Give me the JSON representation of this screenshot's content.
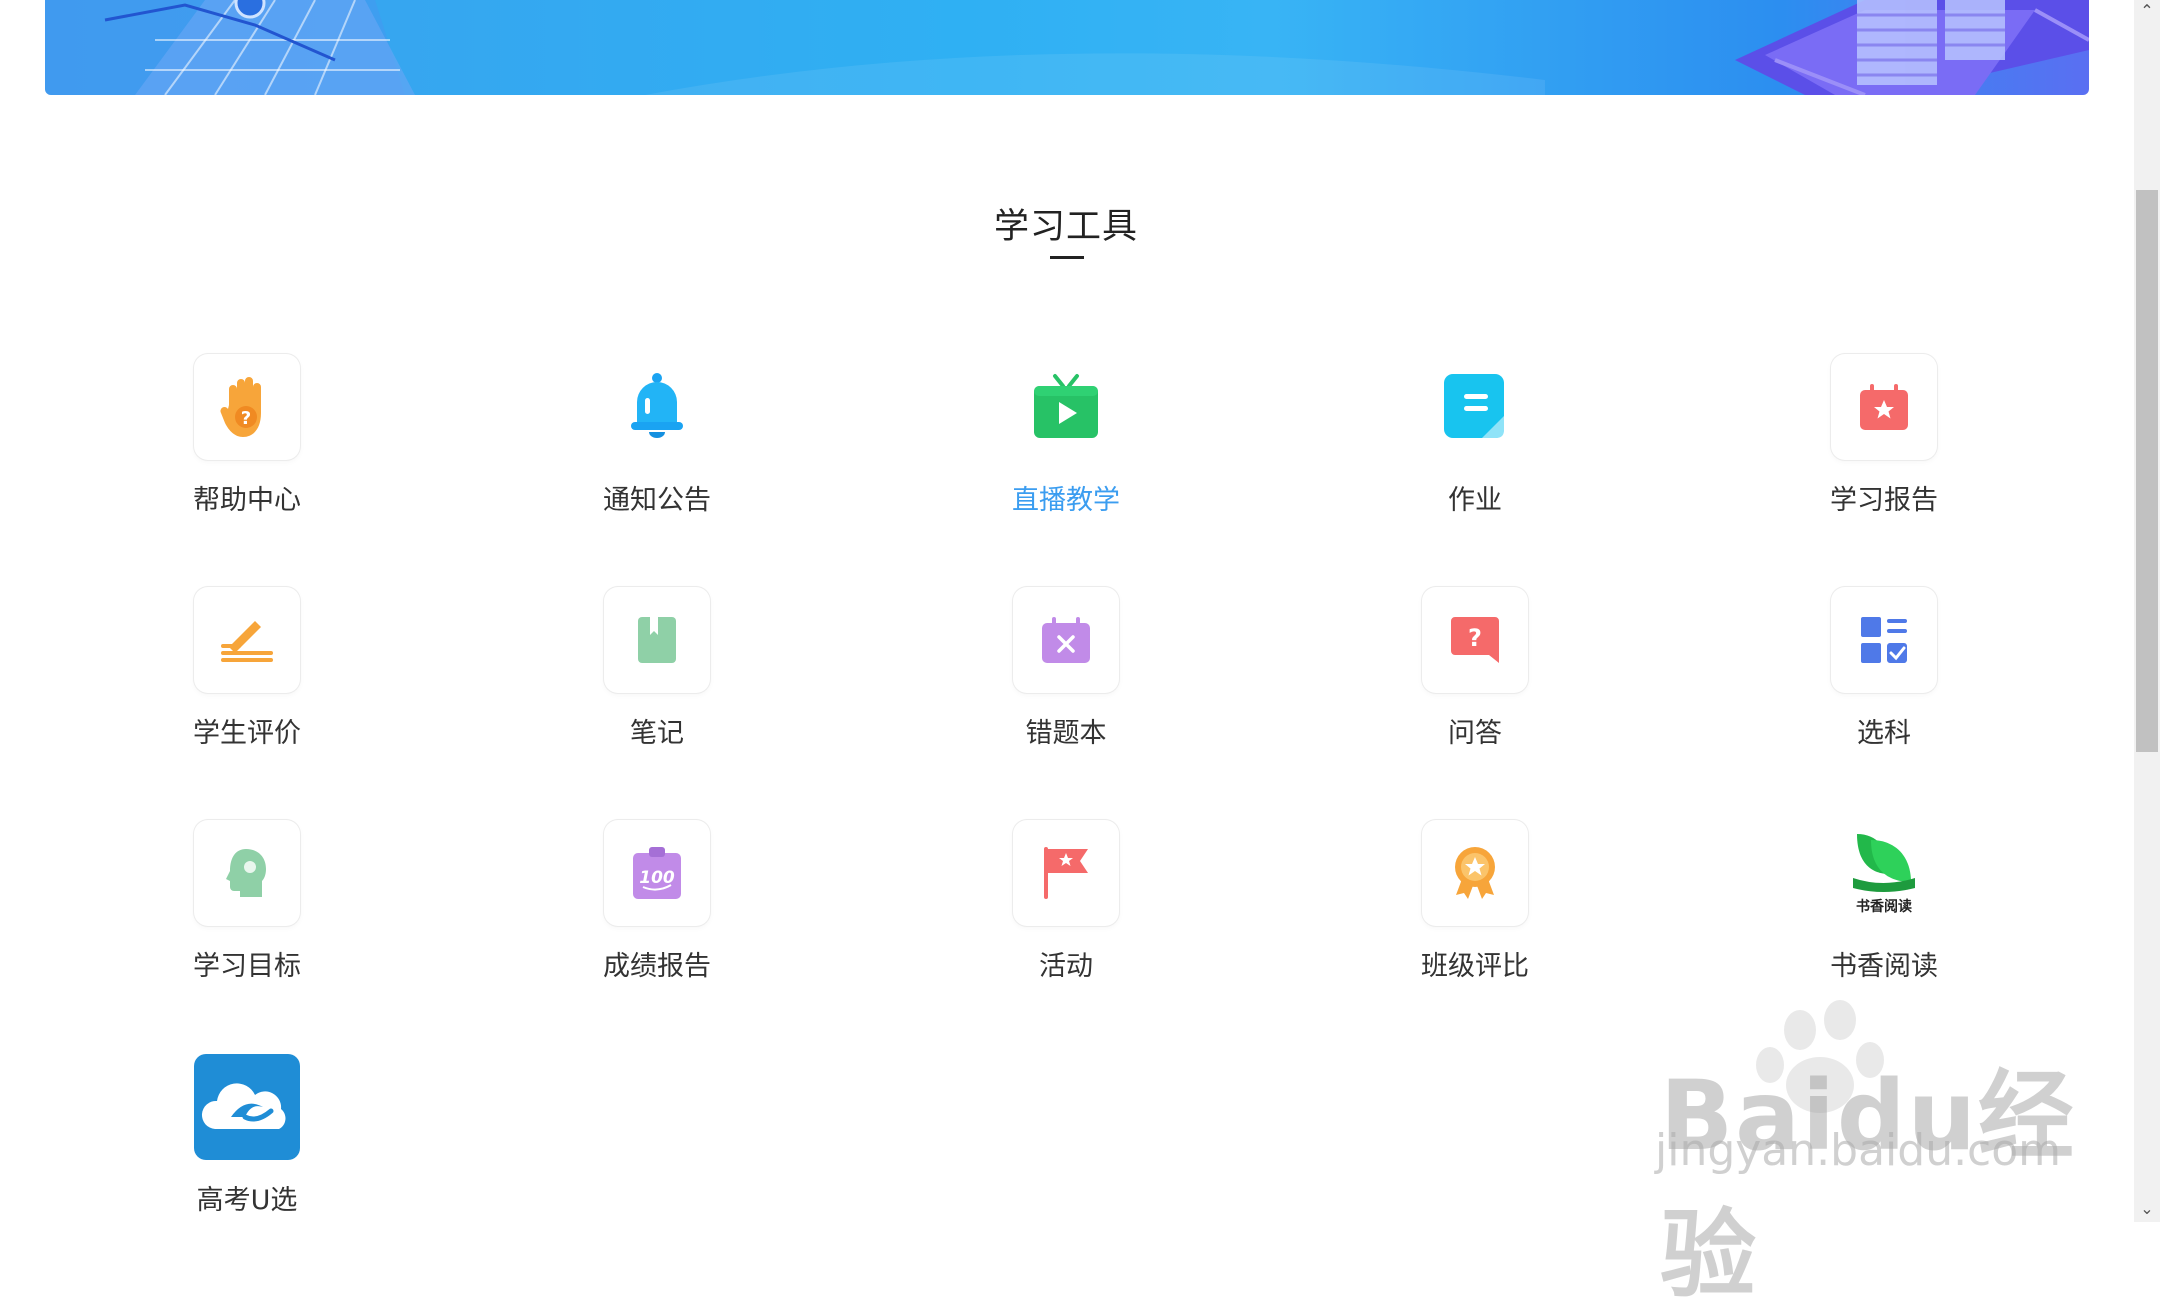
{
  "section": {
    "title": "学习工具"
  },
  "tools": [
    {
      "label": "帮助中心",
      "icon": "help-hand-icon"
    },
    {
      "label": "通知公告",
      "icon": "bell-icon"
    },
    {
      "label": "直播教学",
      "icon": "tv-play-icon",
      "active": true
    },
    {
      "label": "作业",
      "icon": "homework-doc-icon"
    },
    {
      "label": "学习报告",
      "icon": "report-calendar-icon"
    },
    {
      "label": "学生评价",
      "icon": "pen-lines-icon"
    },
    {
      "label": "笔记",
      "icon": "notebook-icon"
    },
    {
      "label": "错题本",
      "icon": "calendar-x-icon"
    },
    {
      "label": "问答",
      "icon": "question-bubble-icon"
    },
    {
      "label": "选科",
      "icon": "grid-check-icon"
    },
    {
      "label": "学习目标",
      "icon": "head-brain-icon"
    },
    {
      "label": "成绩报告",
      "icon": "score-100-icon"
    },
    {
      "label": "活动",
      "icon": "flag-icon"
    },
    {
      "label": "班级评比",
      "icon": "medal-icon"
    },
    {
      "label": "书香阅读",
      "icon": "book-leaf-icon",
      "icon_text": "书香阅读"
    },
    {
      "label": "高考U选",
      "icon": "cloud-bird-icon"
    }
  ],
  "watermark": {
    "text": "Baidu经验",
    "sub": "jingyan.baidu.com"
  },
  "colors": {
    "accent": "#3b9df0"
  }
}
